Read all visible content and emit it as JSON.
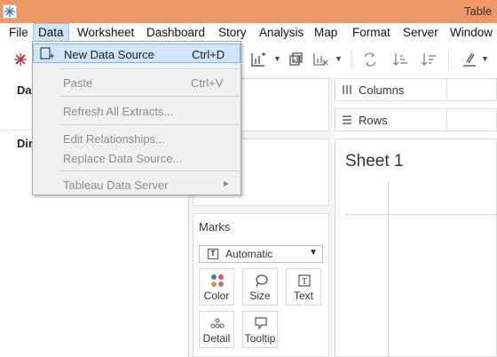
{
  "window": {
    "title": "Table"
  },
  "menubar": {
    "items": [
      "File",
      "Data",
      "Worksheet",
      "Dashboard",
      "Story",
      "Analysis",
      "Map",
      "Format",
      "Server",
      "Window"
    ]
  },
  "data_menu": {
    "new_data_source": {
      "label": "New Data Source",
      "shortcut": "Ctrl+D"
    },
    "paste": {
      "label": "Paste",
      "shortcut": "Ctrl+V"
    },
    "refresh_all_extracts": {
      "label": "Refresh All Extracts..."
    },
    "edit_relationships": {
      "label": "Edit Relationships..."
    },
    "replace_data_source": {
      "label": "Replace Data Source..."
    },
    "tableau_data_server": {
      "label": "Tableau Data Server"
    }
  },
  "left_panel": {
    "heading_1": "Da",
    "heading_2": "Dir"
  },
  "shelves": {
    "columns": "Columns",
    "rows": "Rows"
  },
  "marks": {
    "title": "Marks",
    "type_selected": "Automatic",
    "color": "Color",
    "size": "Size",
    "text": "Text",
    "detail": "Detail",
    "tooltip": "Tooltip"
  },
  "sheet": {
    "title": "Sheet 1"
  },
  "colors": {
    "titlebar": "#ee9666",
    "menu_highlight": "#cce5fb",
    "menu_highlight_border": "#7fb7ea"
  }
}
